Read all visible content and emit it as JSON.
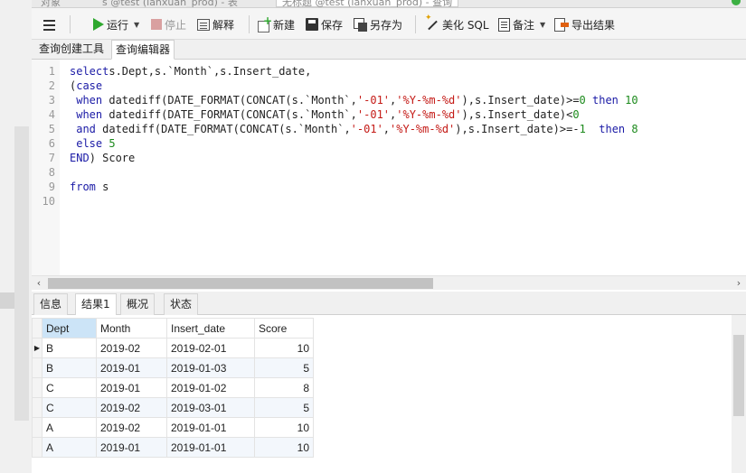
{
  "window_tabs": [
    {
      "label": "对象",
      "active": false
    },
    {
      "label": "s @test (lanxuan_prod) - 表",
      "active": false
    },
    {
      "label": "无标题 @test (lanxuan_prod) - 查询",
      "active": true
    }
  ],
  "toolbar": {
    "run_label": "运行",
    "stop_label": "停止",
    "explain_label": "解释",
    "new_label": "新建",
    "save_label": "保存",
    "saveas_label": "另存为",
    "beautify_label": "美化 SQL",
    "note_label": "备注",
    "export_label": "导出结果"
  },
  "subtabs": [
    {
      "label": "查询创建工具",
      "active": false
    },
    {
      "label": "查询编辑器",
      "active": true
    }
  ],
  "editor": {
    "lines": [
      {
        "n": "1",
        "tokens": [
          [
            "kw",
            "select"
          ],
          [
            "",
            "s.Dept,s.`Month`,s.Insert_date,"
          ]
        ]
      },
      {
        "n": "2",
        "tokens": [
          [
            "",
            "("
          ],
          [
            "kw",
            "case"
          ]
        ]
      },
      {
        "n": "3",
        "tokens": [
          [
            "kw",
            " when"
          ],
          [
            "",
            " datediff(DATE_FORMAT(CONCAT(s.`Month`,"
          ],
          [
            "str",
            "'-01'"
          ],
          [
            "",
            ","
          ],
          [
            "str",
            "'%Y-%m-%d'"
          ],
          [
            "",
            "),s.Insert_date)>="
          ],
          [
            "num",
            "0"
          ],
          [
            "kw",
            " then"
          ],
          [
            "num",
            " 10"
          ]
        ]
      },
      {
        "n": "4",
        "tokens": [
          [
            "kw",
            " when"
          ],
          [
            "",
            " datediff(DATE_FORMAT(CONCAT(s.`Month`,"
          ],
          [
            "str",
            "'-01'"
          ],
          [
            "",
            ","
          ],
          [
            "str",
            "'%Y-%m-%d'"
          ],
          [
            "",
            "),s.Insert_date)<"
          ],
          [
            "num",
            "0"
          ]
        ]
      },
      {
        "n": "5",
        "tokens": [
          [
            "kw",
            " and"
          ],
          [
            "",
            " datediff(DATE_FORMAT(CONCAT(s.`Month`,"
          ],
          [
            "str",
            "'-01'"
          ],
          [
            "",
            ","
          ],
          [
            "str",
            "'%Y-%m-%d'"
          ],
          [
            "",
            "),s.Insert_date)>=-"
          ],
          [
            "num",
            "1"
          ],
          [
            "kw",
            "  then"
          ],
          [
            "num",
            " 8"
          ]
        ]
      },
      {
        "n": "6",
        "tokens": [
          [
            "kw",
            " else"
          ],
          [
            "num",
            " 5"
          ]
        ]
      },
      {
        "n": "7",
        "tokens": [
          [
            "kw",
            "END"
          ],
          [
            "",
            ") Score"
          ]
        ]
      },
      {
        "n": "8",
        "tokens": []
      },
      {
        "n": "9",
        "tokens": [
          [
            "kw",
            "from"
          ],
          [
            "",
            " s"
          ]
        ]
      },
      {
        "n": "10",
        "tokens": []
      }
    ]
  },
  "result_tabs": [
    {
      "label": "信息",
      "active": false
    },
    {
      "label": "结果1",
      "active": true
    },
    {
      "label": "概况",
      "active": false
    },
    {
      "label": "状态",
      "active": false
    }
  ],
  "result": {
    "columns": [
      "Dept",
      "Month",
      "Insert_date",
      "Score"
    ],
    "rows": [
      [
        "B",
        "2019-02",
        "2019-02-01",
        "10"
      ],
      [
        "B",
        "2019-01",
        "2019-01-03",
        "5"
      ],
      [
        "C",
        "2019-01",
        "2019-01-02",
        "8"
      ],
      [
        "C",
        "2019-02",
        "2019-03-01",
        "5"
      ],
      [
        "A",
        "2019-02",
        "2019-01-01",
        "10"
      ],
      [
        "A",
        "2019-01",
        "2019-01-01",
        "10"
      ]
    ],
    "current_row_marker": "▶"
  },
  "colors": {
    "keyword": "#1a1aa6",
    "string": "#c41a16",
    "number": "#1c8a1c",
    "selected_header": "#cce4f7"
  }
}
